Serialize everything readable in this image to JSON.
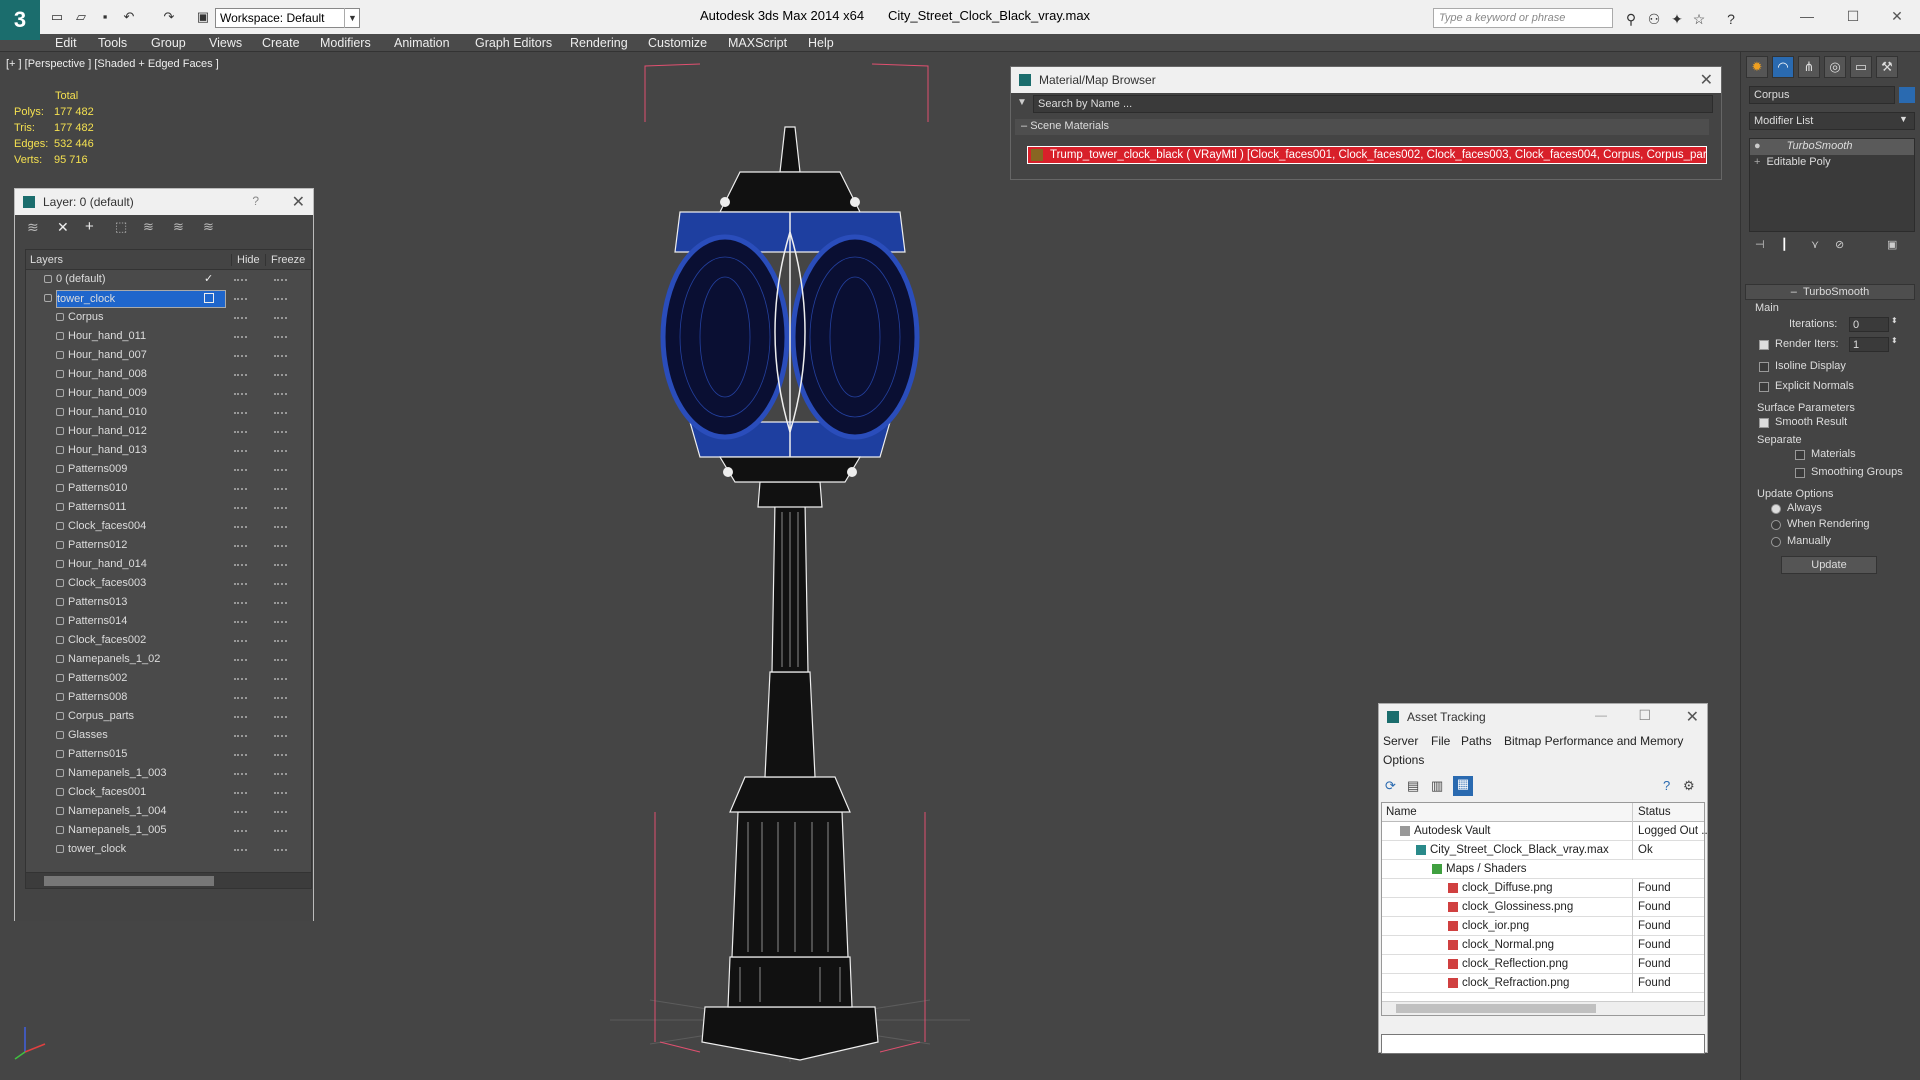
{
  "titlebar": {
    "app_title": "Autodesk 3ds Max  2014 x64",
    "file_title": "City_Street_Clock_Black_vray.max",
    "workspace": "Workspace: Default",
    "search_placeholder": "Type a keyword or phrase"
  },
  "menu": [
    "Edit",
    "Tools",
    "Group",
    "Views",
    "Create",
    "Modifiers",
    "Animation",
    "Graph Editors",
    "Rendering",
    "Customize",
    "MAXScript",
    "Help"
  ],
  "viewport": {
    "label": "[+ ] [Perspective ] [Shaded + Edged Faces ]",
    "stats": {
      "header": "Total",
      "polys_label": "Polys:",
      "polys": "177 482",
      "tris_label": "Tris:",
      "tris": "177 482",
      "edges_label": "Edges:",
      "edges": "532 446",
      "verts_label": "Verts:",
      "verts": "95 716"
    }
  },
  "layers_panel": {
    "title": "Layer: 0 (default)",
    "help": "?",
    "col_layers": "Layers",
    "col_hide": "Hide",
    "col_freeze": "Freeze",
    "items": [
      {
        "name": "0 (default)",
        "level": 0
      },
      {
        "name": "tower_clock",
        "level": 0,
        "selected": true
      },
      {
        "name": "Corpus",
        "level": 1
      },
      {
        "name": "Hour_hand_011",
        "level": 1
      },
      {
        "name": "Hour_hand_007",
        "level": 1
      },
      {
        "name": "Hour_hand_008",
        "level": 1
      },
      {
        "name": "Hour_hand_009",
        "level": 1
      },
      {
        "name": "Hour_hand_010",
        "level": 1
      },
      {
        "name": "Hour_hand_012",
        "level": 1
      },
      {
        "name": "Hour_hand_013",
        "level": 1
      },
      {
        "name": "Patterns009",
        "level": 1
      },
      {
        "name": "Patterns010",
        "level": 1
      },
      {
        "name": "Patterns011",
        "level": 1
      },
      {
        "name": "Clock_faces004",
        "level": 1
      },
      {
        "name": "Patterns012",
        "level": 1
      },
      {
        "name": "Hour_hand_014",
        "level": 1
      },
      {
        "name": "Clock_faces003",
        "level": 1
      },
      {
        "name": "Patterns013",
        "level": 1
      },
      {
        "name": "Patterns014",
        "level": 1
      },
      {
        "name": "Clock_faces002",
        "level": 1
      },
      {
        "name": "Namepanels_1_02",
        "level": 1
      },
      {
        "name": "Patterns002",
        "level": 1
      },
      {
        "name": "Patterns008",
        "level": 1
      },
      {
        "name": "Corpus_parts",
        "level": 1
      },
      {
        "name": "Glasses",
        "level": 1
      },
      {
        "name": "Patterns015",
        "level": 1
      },
      {
        "name": "Namepanels_1_003",
        "level": 1
      },
      {
        "name": "Clock_faces001",
        "level": 1
      },
      {
        "name": "Namepanels_1_004",
        "level": 1
      },
      {
        "name": "Namepanels_1_005",
        "level": 1
      },
      {
        "name": "tower_clock",
        "level": 1
      }
    ]
  },
  "material_browser": {
    "title": "Material/Map Browser",
    "search_placeholder": "Search by Name ...",
    "section": "Scene Materials",
    "material": "Trump_tower_clock_black  ( VRayMtl ) [Clock_faces001, Clock_faces002, Clock_faces003, Clock_faces004, Corpus, Corpus_par..."
  },
  "asset_tracking": {
    "title": "Asset Tracking",
    "menu": [
      "Server",
      "File",
      "Paths",
      "Bitmap Performance and Memory",
      "Options"
    ],
    "col_name": "Name",
    "col_status": "Status",
    "rows": [
      {
        "name": "Autodesk Vault",
        "status": "Logged Out ...",
        "indent": 1
      },
      {
        "name": "City_Street_Clock_Black_vray.max",
        "status": "Ok",
        "indent": 2
      },
      {
        "name": "Maps / Shaders",
        "status": "",
        "indent": 3
      },
      {
        "name": "clock_Diffuse.png",
        "status": "Found",
        "indent": 4
      },
      {
        "name": "clock_Glossiness.png",
        "status": "Found",
        "indent": 4
      },
      {
        "name": "clock_ior.png",
        "status": "Found",
        "indent": 4
      },
      {
        "name": "clock_Normal.png",
        "status": "Found",
        "indent": 4
      },
      {
        "name": "clock_Reflection.png",
        "status": "Found",
        "indent": 4
      },
      {
        "name": "clock_Refraction.png",
        "status": "Found",
        "indent": 4
      }
    ]
  },
  "command_panel": {
    "object_name": "Corpus",
    "modifier_list": "Modifier List",
    "stack": [
      "TurboSmooth",
      "Editable Poly"
    ],
    "rollout_title": "TurboSmooth",
    "main_label": "Main",
    "iterations_label": "Iterations:",
    "iterations": "0",
    "render_iters_label": "Render Iters:",
    "render_iters": "1",
    "isoline": "Isoline Display",
    "explicit_normals": "Explicit Normals",
    "surface_params": "Surface Parameters",
    "smooth_result": "Smooth Result",
    "separate": "Separate",
    "materials": "Materials",
    "smoothing_groups": "Smoothing Groups",
    "update_options": "Update Options",
    "always": "Always",
    "when_rendering": "When Rendering",
    "manually": "Manually",
    "update_button": "Update"
  },
  "colors": {
    "selection": "#1f66cc",
    "wire_blue": "#1e3fa0",
    "stats_yellow": "#f4e050"
  }
}
